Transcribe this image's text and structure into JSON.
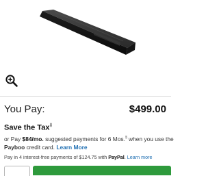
{
  "pricing": {
    "you_pay_label": "You Pay:",
    "price": "$499.00"
  },
  "tax": {
    "title": "Save the Tax",
    "marker": "‡"
  },
  "financing": {
    "prefix": "or Pay ",
    "monthly": "$84/mo.",
    "middle": " suggested payments for 6 Mos.",
    "marker": "§",
    "after_marker": " when you use the",
    "brand": "Payboo",
    "suffix": " credit card. ",
    "learn_more": "Learn More"
  },
  "installment": {
    "prefix": "Pay in 4 interest-free payments of $124.75 with ",
    "brand": "PayPal",
    "suffix": ". ",
    "learn_more": "Learn more"
  },
  "colors": {
    "accent_green": "#2e9a3c",
    "link_blue": "#1f6fb2"
  },
  "icons": {
    "zoom": "zoom-in-icon"
  }
}
